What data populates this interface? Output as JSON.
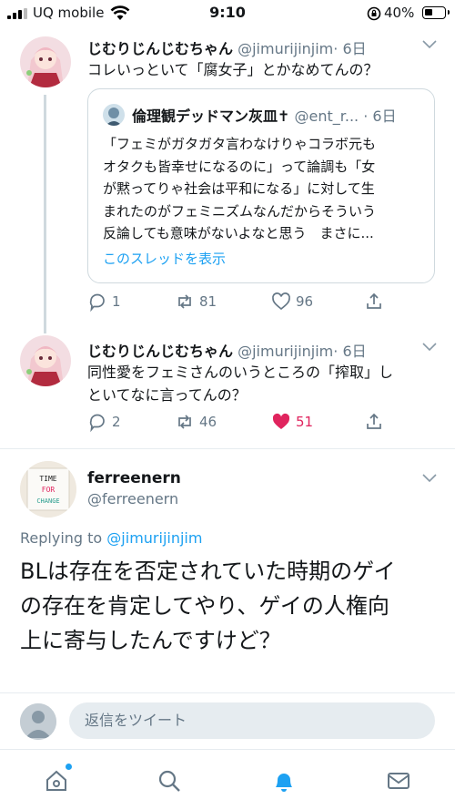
{
  "status_bar": {
    "carrier": "UQ mobile",
    "time": "9:10",
    "battery_percent": "40%"
  },
  "colors": {
    "accent": "#1da1f2",
    "like": "#e0245e",
    "muted": "#657786"
  },
  "thread": [
    {
      "name": "じむりじんじむちゃん",
      "handle": "@jimurijinjim",
      "time": "· 6日",
      "text": "コレいっといて「腐女子」とかなめてんの？",
      "quoted": {
        "name": "倫理観デッドマン灰皿✝",
        "handle": "@ent_r...",
        "time": "· 6日",
        "lines": [
          "「フェミがガタガタ言わなけりゃコラボ元も",
          "オタクも皆幸せになるのに」って論調も「女",
          "が黙ってりゃ社会は平和になる」に対して生",
          "まれたのがフェミニズムなんだからそういう",
          "反論しても意味がないよなと思う　まさに..."
        ],
        "thread_link": "このスレッドを表示"
      },
      "actions": {
        "replies": "1",
        "retweets": "81",
        "likes": "96"
      }
    },
    {
      "name": "じむりじんじむちゃん",
      "handle": "@jimurijinjim",
      "time": "· 6日",
      "lines": [
        "同性愛をフェミさんのいうところの「搾取」し",
        "といてなに言ってんの？"
      ],
      "actions": {
        "replies": "2",
        "retweets": "46",
        "likes": "51"
      }
    }
  ],
  "focused": {
    "name": "ferreenern",
    "handle": "@ferreenern",
    "replying_prefix": "Replying to ",
    "replying_to": "@jimurijinjim",
    "lines": [
      "BLは存在を否定されていた時期のゲイ",
      "の存在を肯定してやり、ゲイの人権向",
      "上に寄与したんですけど？"
    ],
    "avatar_sign": [
      "TIME",
      "FOR",
      "CHANGE"
    ]
  },
  "composer": {
    "placeholder": "返信をツイート"
  },
  "tabs": [
    "home-icon",
    "search-icon",
    "notifications-icon",
    "messages-icon"
  ]
}
